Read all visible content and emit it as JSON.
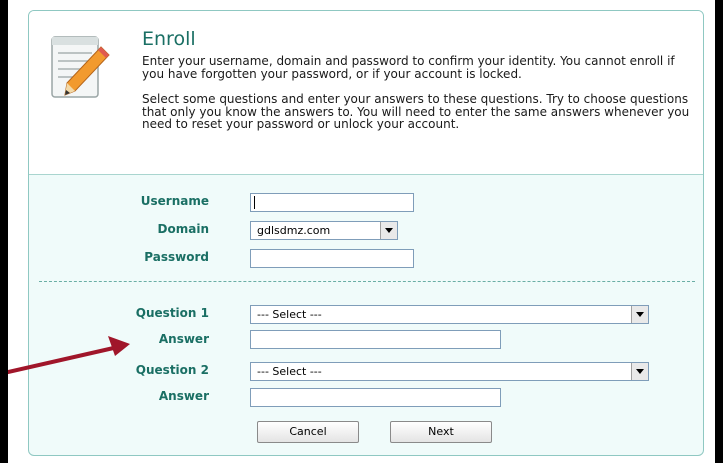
{
  "enroll": {
    "title": "Enroll",
    "intro_paragraph_1": "Enter your username, domain and password to confirm your identity. You cannot enroll if you have forgotten your password, or if your account is locked.",
    "intro_paragraph_2": "Select some questions and enter your answers to these questions. Try to choose questions that only you know the answers to. You will need to enter the same answers whenever you need to reset your password or unlock your account."
  },
  "form": {
    "username_label": "Username",
    "username_value": "",
    "domain_label": "Domain",
    "domain_value": "gdlsdmz.com",
    "password_label": "Password",
    "password_value": "",
    "question1_label": "Question 1",
    "question1_value": "--- Select ---",
    "answer1_label": "Answer",
    "answer1_value": "",
    "question2_label": "Question 2",
    "question2_value": "--- Select ---",
    "answer2_label": "Answer",
    "answer2_value": ""
  },
  "buttons": {
    "cancel": "Cancel",
    "next": "Next"
  },
  "icons": {
    "header": "edit-notepad-pencil-icon",
    "annotation": "red-arrow-annotation"
  },
  "colors": {
    "label_teal": "#1a6f64",
    "panel_background": "#f0fbfa",
    "annotation_red": "#a0162a"
  }
}
